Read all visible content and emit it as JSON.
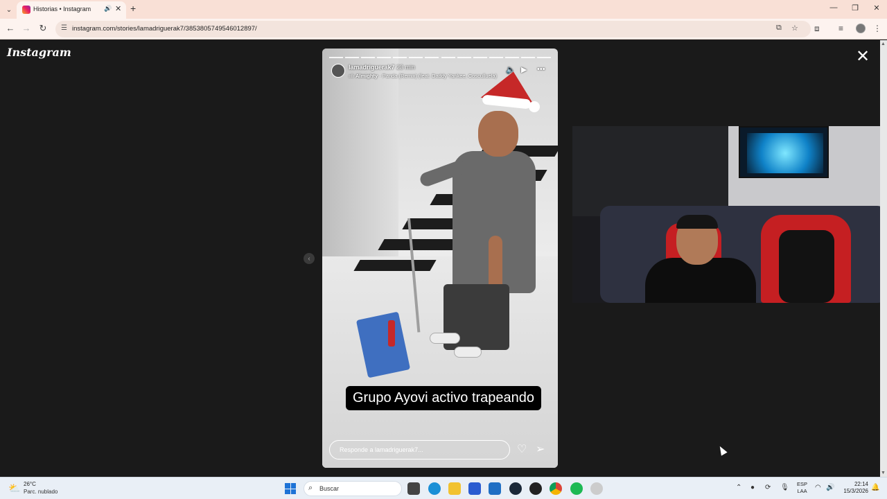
{
  "browser": {
    "tab": {
      "title": "Historias • Instagram"
    },
    "url": "instagram.com/stories/lamadriguerak7/3853805749546012897/"
  },
  "page": {
    "logo": "Instagram"
  },
  "story": {
    "username": "lamadriguerak7",
    "time": "23 min",
    "music_title": "Almighty",
    "music_subtitle": "· Panda (Remix) (feat. Daddy Yankee, Cosculluela)",
    "caption": "Grupo Ayovi activo trapeando",
    "reply_placeholder": "Responde a lamadriguerak7...",
    "progress_segments": 14,
    "colors": {
      "caption_bg": "#000000",
      "hat": "#c62828",
      "mop": "#3f6fc0"
    }
  },
  "taskbar": {
    "weather_temp": "26°C",
    "weather_desc": "Parc. nublado",
    "search_text": "Buscar",
    "lang_line1": "ESP",
    "lang_line2": "LAA",
    "time": "22:14",
    "date": "15/3/2026"
  }
}
